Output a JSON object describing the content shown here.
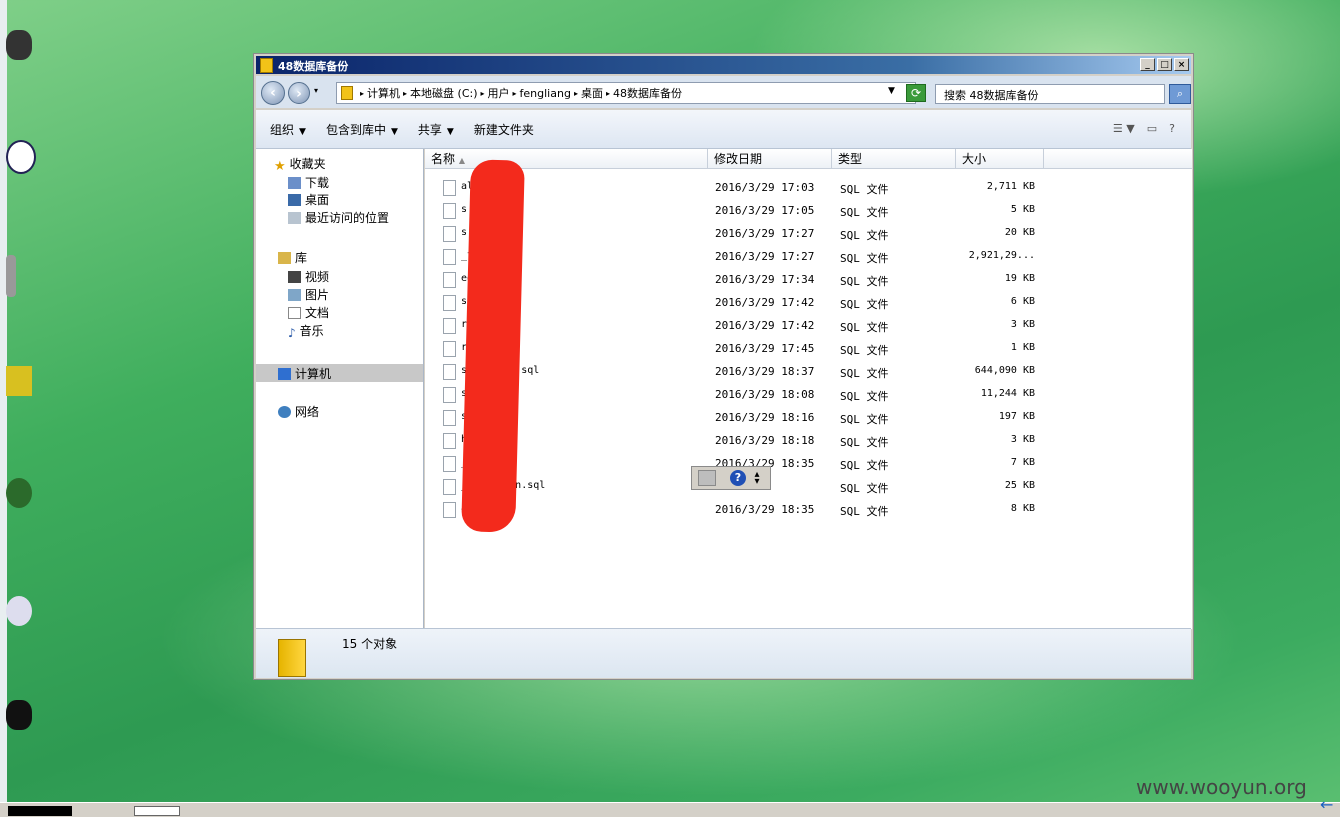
{
  "window": {
    "title": "48数据库备份"
  },
  "address": {
    "crumbs": [
      "计算机",
      "本地磁盘 (C:)",
      "用户",
      "fengliang",
      "桌面",
      "48数据库备份"
    ],
    "search_placeholder": "搜索 48数据库备份"
  },
  "toolbar": {
    "organize": "组织",
    "include_library": "包含到库中",
    "share": "共享",
    "new_folder": "新建文件夹"
  },
  "nav": {
    "favorites": "收藏夹",
    "downloads": "下载",
    "desktop": "桌面",
    "recent": "最近访问的位置",
    "libraries": "库",
    "videos": "视频",
    "pictures": "图片",
    "documents": "文档",
    "music": "音乐",
    "computer": "计算机",
    "network": "网络"
  },
  "columns": {
    "name": "名称",
    "date": "修改日期",
    "type": "类型",
    "size": "大小"
  },
  "files": [
    {
      "name": "al          fo.sql",
      "date": "2016/3/29 17:03",
      "type": "SQL 文件",
      "size": "2,711 KB"
    },
    {
      "name": "s           ry.sql",
      "date": "2016/3/29 17:05",
      "type": "SQL 文件",
      "size": "5 KB"
    },
    {
      "name": "s          port.sql",
      "date": "2016/3/29 17:27",
      "type": "SQL 文件",
      "size": "20 KB"
    },
    {
      "name": "           _tags.sql",
      "date": "2016/3/29 17:27",
      "type": "SQL 文件",
      "size": "2,921,29..."
    },
    {
      "name": "           eduler.sql",
      "date": "2016/3/29 17:34",
      "type": "SQL 文件",
      "size": "19 KB"
    },
    {
      "name": "           sql",
      "date": "2016/3/29 17:42",
      "type": "SQL 文件",
      "size": "6 KB"
    },
    {
      "name": "r",
      "date": "2016/3/29 17:42",
      "type": "SQL 文件",
      "size": "3 KB"
    },
    {
      "name": "r          .sql",
      "date": "2016/3/29 17:45",
      "type": "SQL 文件",
      "size": "1 KB"
    },
    {
      "name": "s          _client.sql",
      "date": "2016/3/29 18:37",
      "type": "SQL 文件",
      "size": "644,090 KB"
    },
    {
      "name": "           s.sql",
      "date": "2016/3/29 18:08",
      "type": "SQL 文件",
      "size": "11,244 KB"
    },
    {
      "name": "           sql",
      "date": "2016/3/29 18:16",
      "type": "SQL 文件",
      "size": "197 KB"
    },
    {
      "name": "           hl.sql",
      "date": "2016/3/29 18:18",
      "type": "SQL 文件",
      "size": "3 KB"
    },
    {
      "name": "           _sys.sql",
      "date": "2016/3/29 18:35",
      "type": "SQL 文件",
      "size": "7 KB"
    },
    {
      "name": "           _promotion.sql",
      "date": "18:35",
      "type": "SQL 文件",
      "size": "25 KB"
    },
    {
      "name": "           ata.sql",
      "date": "2016/3/29 18:35",
      "type": "SQL 文件",
      "size": "8 KB"
    }
  ],
  "status": {
    "count": "15 个对象"
  },
  "watermark": "www.wooyun.org",
  "colors": {
    "title_start": "#0a246a",
    "title_end": "#a6caf0",
    "redaction": "#f32a1c",
    "desktop_green": "#3fae5d"
  }
}
